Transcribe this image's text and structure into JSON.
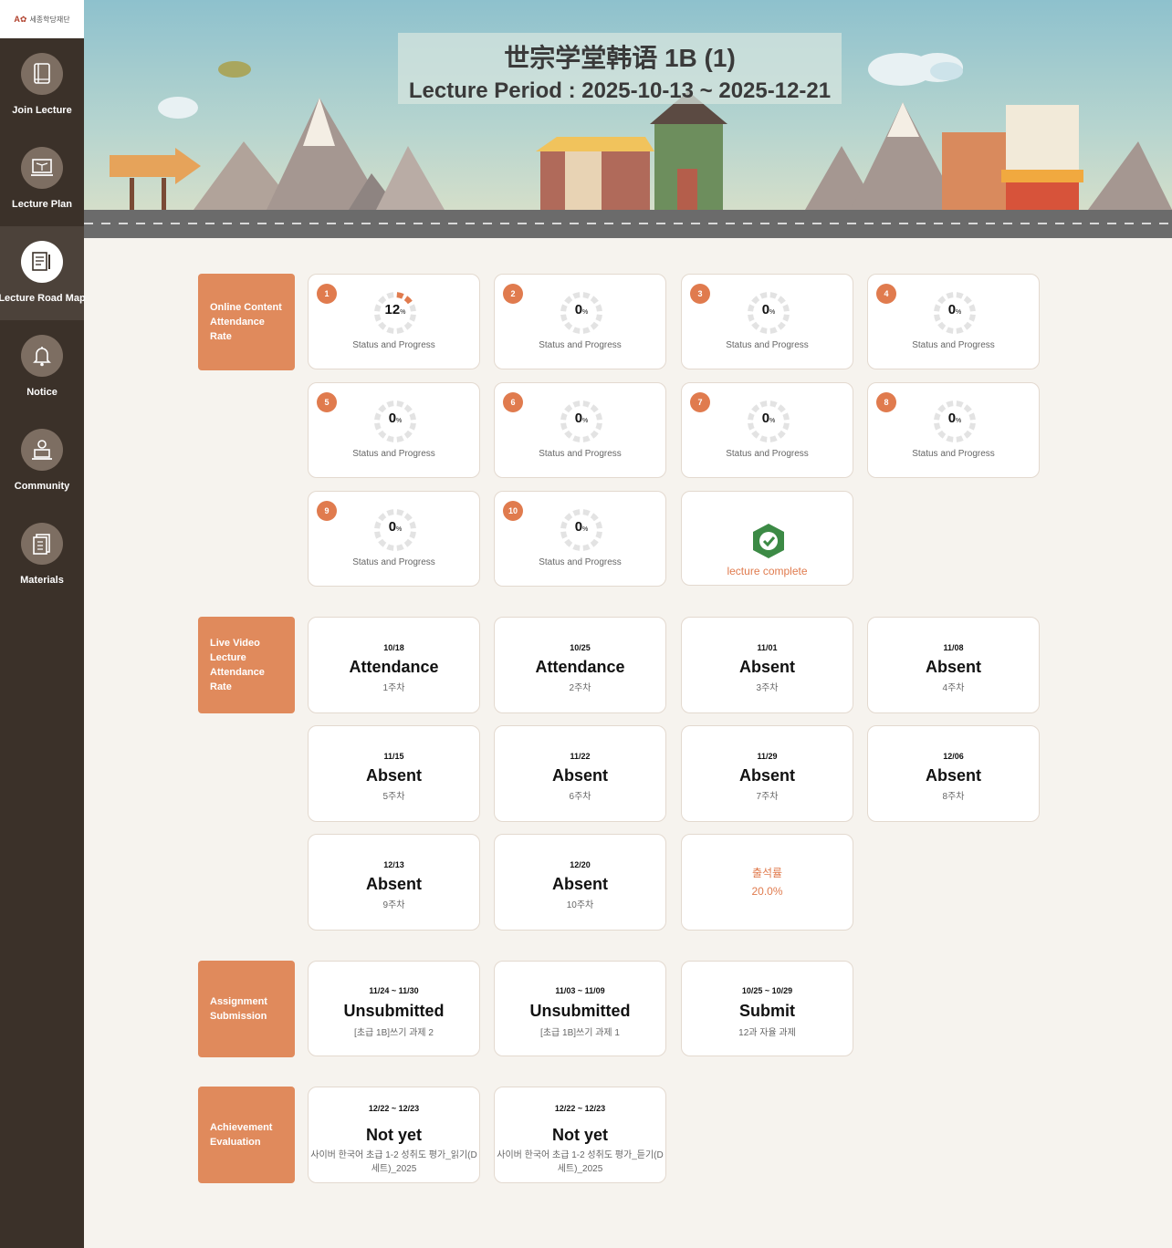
{
  "sidebar": {
    "logo_mark": "A✿",
    "logo_text": "세종학당재단",
    "items": [
      {
        "label": "Join Lecture",
        "icon": "book-icon",
        "active": false
      },
      {
        "label": "Lecture Plan",
        "icon": "laptop-book-icon",
        "active": false
      },
      {
        "label": "Lecture Road Map",
        "icon": "document-pen-icon",
        "active": true
      },
      {
        "label": "Notice",
        "icon": "bell-icon",
        "active": false
      },
      {
        "label": "Community",
        "icon": "person-laptop-icon",
        "active": false
      },
      {
        "label": "Materials",
        "icon": "file-icon",
        "active": false
      }
    ]
  },
  "banner": {
    "title": "世宗学堂韩语 1B (1)",
    "period": "Lecture Period : 2025-10-13 ~ 2025-12-21"
  },
  "online": {
    "label": "Online Content Attendance Rate",
    "caption": "Status and Progress",
    "percent_suffix": "%",
    "items": [
      {
        "num": "1",
        "value": "12"
      },
      {
        "num": "2",
        "value": "0"
      },
      {
        "num": "3",
        "value": "0"
      },
      {
        "num": "4",
        "value": "0"
      },
      {
        "num": "5",
        "value": "0"
      },
      {
        "num": "6",
        "value": "0"
      },
      {
        "num": "7",
        "value": "0"
      },
      {
        "num": "8",
        "value": "0"
      },
      {
        "num": "9",
        "value": "0"
      },
      {
        "num": "10",
        "value": "0"
      }
    ],
    "complete_text": "lecture complete",
    "complete_icon": "check-shield-icon",
    "accent_color": "#e07b4e"
  },
  "live": {
    "label": "Live Video Lecture Attendance Rate",
    "items": [
      {
        "date": "10/18",
        "status": "Attendance",
        "week": "1주차"
      },
      {
        "date": "10/25",
        "status": "Attendance",
        "week": "2주차"
      },
      {
        "date": "11/01",
        "status": "Absent",
        "week": "3주차"
      },
      {
        "date": "11/08",
        "status": "Absent",
        "week": "4주차"
      },
      {
        "date": "11/15",
        "status": "Absent",
        "week": "5주차"
      },
      {
        "date": "11/22",
        "status": "Absent",
        "week": "6주차"
      },
      {
        "date": "11/29",
        "status": "Absent",
        "week": "7주차"
      },
      {
        "date": "12/06",
        "status": "Absent",
        "week": "8주차"
      },
      {
        "date": "12/13",
        "status": "Absent",
        "week": "9주차"
      },
      {
        "date": "12/20",
        "status": "Absent",
        "week": "10주차"
      }
    ],
    "rate_label": "출석률",
    "rate_value": "20.0%"
  },
  "assignment": {
    "label": "Assignment Submission",
    "items": [
      {
        "date": "11/24 ~ 11/30",
        "status": "Unsubmitted",
        "title": "[초급 1B]쓰기 과제 2"
      },
      {
        "date": "11/03 ~ 11/09",
        "status": "Unsubmitted",
        "title": "[초급 1B]쓰기 과제 1"
      },
      {
        "date": "10/25 ~ 10/29",
        "status": "Submit",
        "title": "12과 자율 과제"
      }
    ]
  },
  "achievement": {
    "label": "Achievement Evaluation",
    "items": [
      {
        "date": "12/22 ~ 12/23",
        "status": "Not yet",
        "title": "사이버 한국어 초급 1-2 성취도 평가_읽기(D세트)_2025"
      },
      {
        "date": "12/22 ~ 12/23",
        "status": "Not yet",
        "title": "사이버 한국어 초급 1-2 성취도 평가_듣기(D세트)_2025"
      }
    ]
  }
}
